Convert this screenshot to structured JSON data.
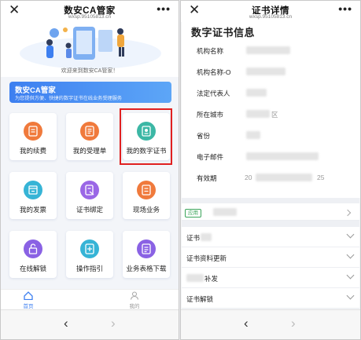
{
  "left": {
    "title": "数安CA管家",
    "domain": "wxsp.95105813.cn",
    "close_glyph": "✕",
    "more_glyph": "•••",
    "welcome": "欢迎来到数安CA管家！",
    "banner": {
      "title": "数安CA管家",
      "subtitle": "为您提供方便、快捷的数字证书在线业务受理服务"
    },
    "tiles": [
      {
        "label": "我的续费",
        "icon": "renew-doc-icon",
        "color": "#f07a3c"
      },
      {
        "label": "我的受理单",
        "icon": "order-doc-icon",
        "color": "#f07a3c"
      },
      {
        "label": "我的数字证书",
        "icon": "certificate-icon",
        "color": "#3cb7a5"
      },
      {
        "label": "我的发票",
        "icon": "invoice-icon",
        "color": "#36b4d6"
      },
      {
        "label": "证书绑定",
        "icon": "bind-certificate-icon",
        "color": "#9a67e6"
      },
      {
        "label": "现场业务",
        "icon": "onsite-service-icon",
        "color": "#f07a3c"
      },
      {
        "label": "在线解锁",
        "icon": "unlock-icon",
        "color": "#8a62e4"
      },
      {
        "label": "操作指引",
        "icon": "guide-icon",
        "color": "#36b4d6"
      },
      {
        "label": "业务表格下载",
        "icon": "download-form-icon",
        "color": "#8a62e4"
      }
    ],
    "tabs": [
      {
        "label": "首页",
        "icon": "home-icon",
        "active": true
      },
      {
        "label": "我的",
        "icon": "user-icon",
        "active": false
      }
    ]
  },
  "right": {
    "title": "证书详情",
    "domain": "wxsp.95105813.cn",
    "card_title": "数字证书信息",
    "rows": [
      {
        "label": "机构名称",
        "value": ""
      },
      {
        "label": "机构名称-O",
        "value": ""
      },
      {
        "label": "法定代表人",
        "value": ""
      },
      {
        "label": "所在城市",
        "value": "区"
      },
      {
        "label": "省份",
        "value": ""
      },
      {
        "label": "电子邮件",
        "value": ""
      },
      {
        "label": "有效期",
        "value": "20",
        "value_end": "25"
      }
    ],
    "app_badge": "应用",
    "sections": [
      {
        "label": "证书"
      },
      {
        "label": "证书资料更新"
      },
      {
        "label": "补发"
      },
      {
        "label": "证书解锁"
      }
    ]
  },
  "nav": {
    "back_glyph": "‹",
    "forward_glyph": "›"
  },
  "colors": {
    "accent": "#3d7ff0",
    "highlight_border": "#e02020",
    "badge_green": "#3aa45a"
  }
}
